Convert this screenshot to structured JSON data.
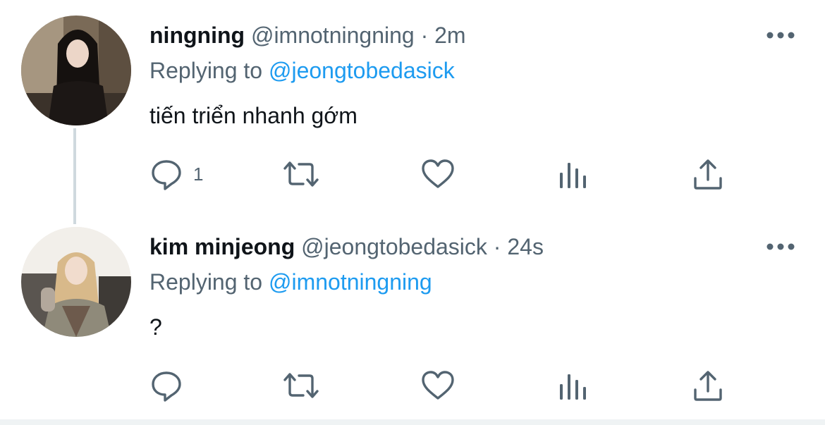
{
  "tweets": [
    {
      "name": "ningning",
      "handle": "@imnotningning",
      "separator": "·",
      "time": "2m",
      "replying_prefix": "Replying to ",
      "replying_to": "@jeongtobedasick",
      "text": "tiến triển nhanh gớm",
      "reply_count": "1",
      "icons": [
        "reply-icon",
        "retweet-icon",
        "like-icon",
        "views-icon",
        "share-icon",
        "more-icon"
      ]
    },
    {
      "name": "kim minjeong",
      "handle": "@jeongtobedasick",
      "separator": "·",
      "time": "24s",
      "replying_prefix": "Replying to ",
      "replying_to": "@imnotningning",
      "text": "?",
      "reply_count": "",
      "icons": [
        "reply-icon",
        "retweet-icon",
        "like-icon",
        "views-icon",
        "share-icon",
        "more-icon"
      ]
    }
  ],
  "colors": {
    "text_primary": "#0f1419",
    "text_secondary": "#536471",
    "link": "#1d9bf0",
    "icon": "#536471",
    "thread_line": "#cfd9de"
  }
}
